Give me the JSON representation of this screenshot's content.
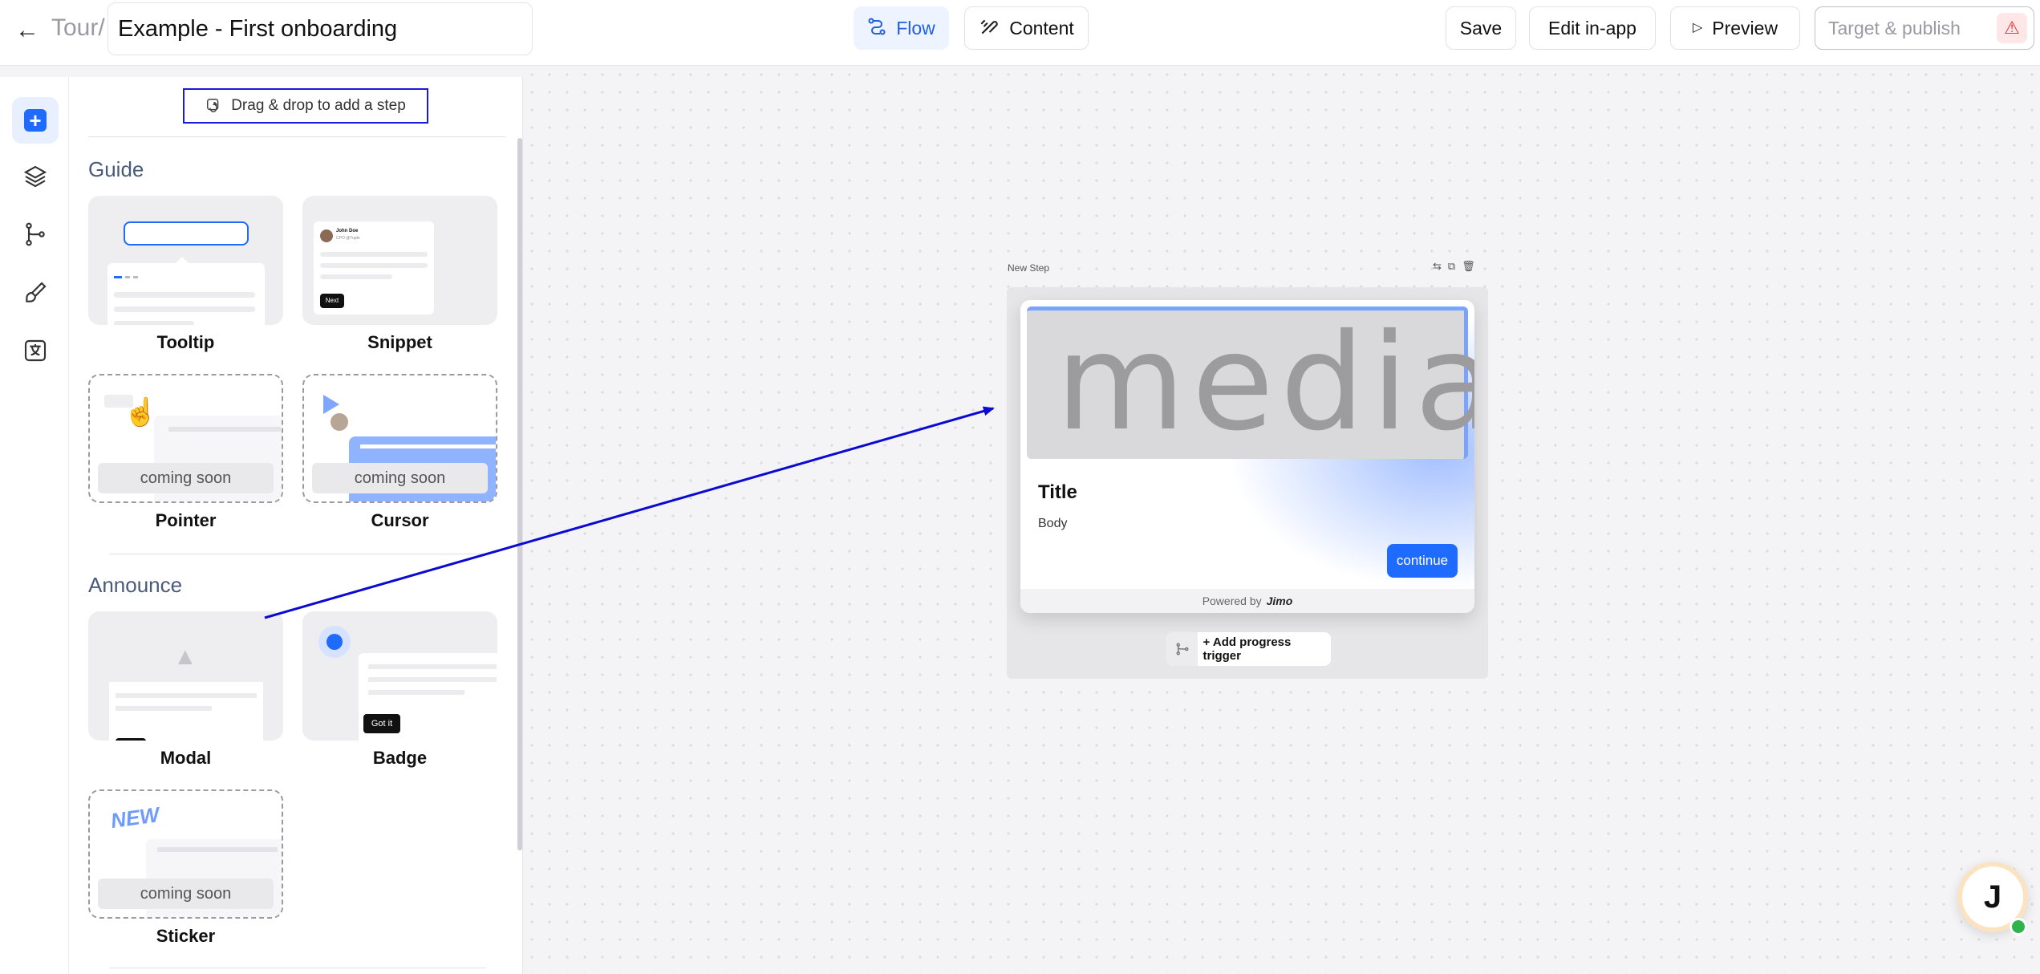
{
  "header": {
    "crumb": "Tour/",
    "title_value": "Example - First onboarding",
    "flow_label": "Flow",
    "content_label": "Content",
    "save_label": "Save",
    "edit_in_app_label": "Edit in-app",
    "preview_label": "Preview",
    "target_publish_label": "Target & publish"
  },
  "library": {
    "drag_hint": "Drag & drop to add a step",
    "guide_title": "Guide",
    "announce_title": "Announce",
    "coming_soon": "coming soon",
    "items": {
      "tooltip": "Tooltip",
      "snippet": "Snippet",
      "pointer": "Pointer",
      "cursor": "Cursor",
      "modal": "Modal",
      "badge": "Badge",
      "sticker": "Sticker"
    },
    "thumb": {
      "next": "Next",
      "got_it": "Got it",
      "new": "NEW",
      "snippet_name": "John Doe",
      "snippet_role": "CPO @Tuple"
    }
  },
  "canvas": {
    "step_label": "New Step",
    "media_text": "media",
    "card_title": "Title",
    "card_body": "Body",
    "continue_label": "continue",
    "powered_by": "Powered by",
    "brand": "Jimo",
    "add_progress_trigger": "+ Add progress trigger"
  },
  "avatar_letter": "J",
  "colors": {
    "accent": "#1f6bff",
    "drag_border": "#1a1ad6",
    "arrow": "#0a0ad0",
    "online": "#2fb34a"
  }
}
